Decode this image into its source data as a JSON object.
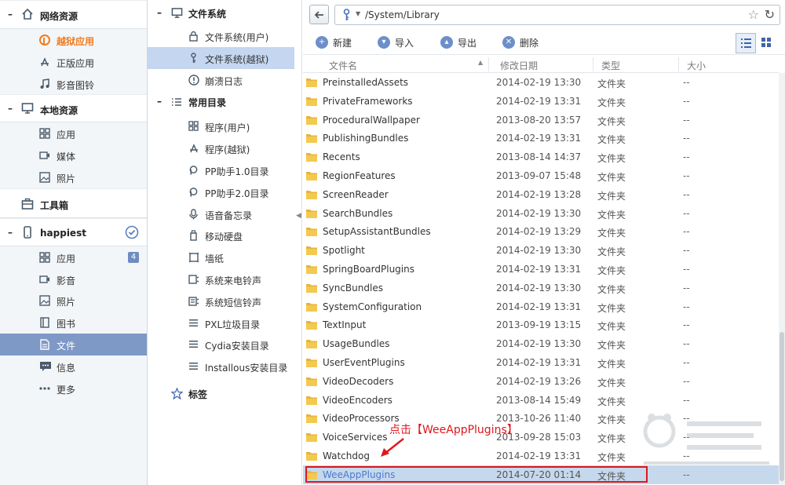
{
  "sidebar": {
    "sections": [
      {
        "title": "网络资源",
        "items": [
          {
            "label": "越狱应用",
            "state": "active"
          },
          {
            "label": "正版应用"
          },
          {
            "label": "影音图铃"
          }
        ]
      },
      {
        "title": "本地资源",
        "items": [
          {
            "label": "应用"
          },
          {
            "label": "媒体"
          },
          {
            "label": "照片"
          }
        ]
      },
      {
        "title": "工具箱",
        "items": []
      },
      {
        "title": "happiest",
        "items": [
          {
            "label": "应用",
            "badge": "4"
          },
          {
            "label": "影音"
          },
          {
            "label": "照片"
          },
          {
            "label": "图书"
          },
          {
            "label": "文件",
            "state": "selected"
          },
          {
            "label": "信息"
          },
          {
            "label": "更多"
          }
        ]
      }
    ]
  },
  "dirs": {
    "fs_title": "文件系统",
    "fs_items": [
      {
        "label": "文件系统(用户)"
      },
      {
        "label": "文件系统(越狱)",
        "state": "selected"
      },
      {
        "label": "崩溃日志"
      }
    ],
    "common_title": "常用目录",
    "common_items": [
      {
        "label": "程序(用户)"
      },
      {
        "label": "程序(越狱)"
      },
      {
        "label": "PP助手1.0目录"
      },
      {
        "label": "PP助手2.0目录"
      },
      {
        "label": "语音备忘录"
      },
      {
        "label": "移动硬盘"
      },
      {
        "label": "墙纸"
      },
      {
        "label": "系统来电铃声"
      },
      {
        "label": "系统短信铃声"
      },
      {
        "label": "PXL垃圾目录"
      },
      {
        "label": "Cydia安装目录"
      },
      {
        "label": "Installous安装目录"
      }
    ],
    "tags_title": "标签"
  },
  "address": {
    "path": "/System/Library"
  },
  "toolbar": {
    "new": "新建",
    "import": "导入",
    "export": "导出",
    "delete": "删除"
  },
  "table": {
    "columns": {
      "name": "文件名",
      "date": "修改日期",
      "type": "类型",
      "size": "大小"
    },
    "rows": [
      {
        "name": "PreinstalledAssets",
        "date": "2014-02-19 13:30",
        "type": "文件夹",
        "size": "--"
      },
      {
        "name": "PrivateFrameworks",
        "date": "2014-02-19 13:31",
        "type": "文件夹",
        "size": "--"
      },
      {
        "name": "ProceduralWallpaper",
        "date": "2013-08-20 13:57",
        "type": "文件夹",
        "size": "--"
      },
      {
        "name": "PublishingBundles",
        "date": "2014-02-19 13:31",
        "type": "文件夹",
        "size": "--"
      },
      {
        "name": "Recents",
        "date": "2013-08-14 14:37",
        "type": "文件夹",
        "size": "--"
      },
      {
        "name": "RegionFeatures",
        "date": "2013-09-07 15:48",
        "type": "文件夹",
        "size": "--"
      },
      {
        "name": "ScreenReader",
        "date": "2014-02-19 13:28",
        "type": "文件夹",
        "size": "--"
      },
      {
        "name": "SearchBundles",
        "date": "2014-02-19 13:30",
        "type": "文件夹",
        "size": "--"
      },
      {
        "name": "SetupAssistantBundles",
        "date": "2014-02-19 13:29",
        "type": "文件夹",
        "size": "--"
      },
      {
        "name": "Spotlight",
        "date": "2014-02-19 13:30",
        "type": "文件夹",
        "size": "--"
      },
      {
        "name": "SpringBoardPlugins",
        "date": "2014-02-19 13:31",
        "type": "文件夹",
        "size": "--"
      },
      {
        "name": "SyncBundles",
        "date": "2014-02-19 13:30",
        "type": "文件夹",
        "size": "--"
      },
      {
        "name": "SystemConfiguration",
        "date": "2014-02-19 13:31",
        "type": "文件夹",
        "size": "--"
      },
      {
        "name": "TextInput",
        "date": "2013-09-19 13:15",
        "type": "文件夹",
        "size": "--"
      },
      {
        "name": "UsageBundles",
        "date": "2014-02-19 13:30",
        "type": "文件夹",
        "size": "--"
      },
      {
        "name": "UserEventPlugins",
        "date": "2014-02-19 13:31",
        "type": "文件夹",
        "size": "--"
      },
      {
        "name": "VideoDecoders",
        "date": "2014-02-19 13:26",
        "type": "文件夹",
        "size": "--"
      },
      {
        "name": "VideoEncoders",
        "date": "2013-08-14 15:49",
        "type": "文件夹",
        "size": "--"
      },
      {
        "name": "VideoProcessors",
        "date": "2013-10-26 11:40",
        "type": "文件夹",
        "size": "--"
      },
      {
        "name": "VoiceServices",
        "date": "2013-09-28 15:03",
        "type": "文件夹",
        "size": "--"
      },
      {
        "name": "Watchdog",
        "date": "2014-02-19 13:31",
        "type": "文件夹",
        "size": "--"
      },
      {
        "name": "WeeAppPlugins",
        "date": "2014-07-20 01:14",
        "type": "文件夹",
        "size": "--",
        "state": "selected"
      }
    ]
  },
  "annotation": {
    "text": "点击【WeeAppPlugins】"
  },
  "colors": {
    "accent": "#7f99c7",
    "highlight": "#e0161c",
    "orange": "#f07c1e",
    "selection": "#c6d8ec"
  }
}
